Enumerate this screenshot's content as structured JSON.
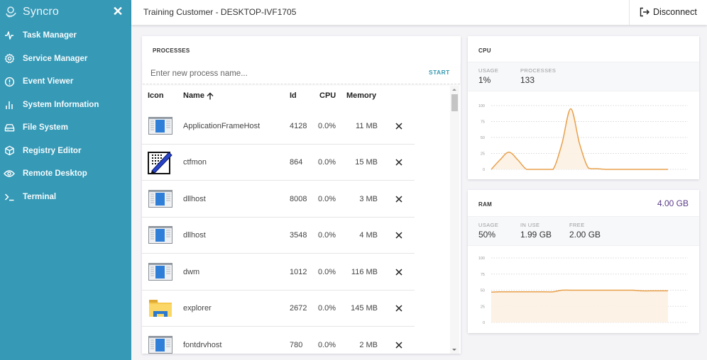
{
  "brand": {
    "name": "Syncro",
    "close_icon": "close-icon"
  },
  "sidebar": {
    "items": [
      {
        "label": "Task Manager",
        "icon": "pulse-icon"
      },
      {
        "label": "Service Manager",
        "icon": "gear-icon"
      },
      {
        "label": "Event Viewer",
        "icon": "alert-circle-icon"
      },
      {
        "label": "System Information",
        "icon": "bar-chart-icon"
      },
      {
        "label": "File System",
        "icon": "hard-drive-icon"
      },
      {
        "label": "Registry Editor",
        "icon": "cube-icon"
      },
      {
        "label": "Remote Desktop",
        "icon": "eye-icon"
      },
      {
        "label": "Terminal",
        "icon": "terminal-icon"
      }
    ]
  },
  "header": {
    "title": "Training Customer - DESKTOP-IVF1705",
    "disconnect_label": "Disconnect"
  },
  "processes": {
    "title": "PROCESSES",
    "input_placeholder": "Enter new process name...",
    "input_value": "",
    "start_label": "START",
    "columns": {
      "icon": "Icon",
      "name": "Name",
      "id": "Id",
      "cpu": "CPU",
      "memory": "Memory"
    },
    "sort": {
      "column": "name",
      "direction": "ascending"
    },
    "rows": [
      {
        "icon": "app-window-icon",
        "name": "ApplicationFrameHost",
        "id": "4128",
        "cpu": "0.0%",
        "memory": "11 MB"
      },
      {
        "icon": "notepad-pen-icon",
        "name": "ctfmon",
        "id": "864",
        "cpu": "0.0%",
        "memory": "15 MB"
      },
      {
        "icon": "app-window-icon",
        "name": "dllhost",
        "id": "8008",
        "cpu": "0.0%",
        "memory": "3 MB"
      },
      {
        "icon": "app-window-icon",
        "name": "dllhost",
        "id": "3548",
        "cpu": "0.0%",
        "memory": "4 MB"
      },
      {
        "icon": "app-window-icon",
        "name": "dwm",
        "id": "1012",
        "cpu": "0.0%",
        "memory": "116 MB"
      },
      {
        "icon": "folder-explorer-icon",
        "name": "explorer",
        "id": "2672",
        "cpu": "0.0%",
        "memory": "145 MB"
      },
      {
        "icon": "app-window-icon",
        "name": "fontdrvhost",
        "id": "780",
        "cpu": "0.0%",
        "memory": "2 MB"
      }
    ]
  },
  "cpu": {
    "title": "CPU",
    "stats": [
      {
        "label": "USAGE",
        "value": "1%"
      },
      {
        "label": "PROCESSES",
        "value": "133"
      }
    ]
  },
  "ram": {
    "title": "RAM",
    "total": "4.00 GB",
    "stats": [
      {
        "label": "USAGE",
        "value": "50%"
      },
      {
        "label": "IN USE",
        "value": "1.99 GB"
      },
      {
        "label": "FREE",
        "value": "2.00 GB"
      }
    ]
  },
  "colors": {
    "sidebar_bg": "#3699b6",
    "accent": "#3a9ab3",
    "chart_line": "#e8a04a",
    "chart_fill": "#fdf1e3",
    "ram_total": "#5b3d8a"
  },
  "chart_data": [
    {
      "type": "area",
      "title": "CPU",
      "ylim": [
        0,
        100
      ],
      "yticks": [
        "0",
        "25",
        "50",
        "75",
        "100"
      ],
      "grid": true,
      "x": [
        0,
        1,
        2,
        3,
        4,
        5,
        6,
        7,
        8,
        9,
        10,
        11,
        12,
        13,
        14,
        15,
        16,
        17,
        18,
        19,
        20
      ],
      "values": [
        0,
        15,
        27,
        15,
        0,
        0,
        0,
        0,
        40,
        95,
        40,
        2,
        1,
        0,
        0,
        0,
        0,
        0,
        0,
        0,
        0
      ]
    },
    {
      "type": "area",
      "title": "RAM",
      "ylim": [
        0,
        100
      ],
      "yticks": [
        "0",
        "25",
        "50",
        "75",
        "100"
      ],
      "grid": true,
      "x": [
        0,
        1,
        2,
        3,
        4,
        5,
        6,
        7,
        8,
        9,
        10,
        11,
        12,
        13,
        14,
        15,
        16,
        17,
        18,
        19,
        20
      ],
      "values": [
        47,
        47.5,
        47.5,
        47.5,
        47.5,
        47.5,
        47.5,
        47.5,
        50,
        50,
        50,
        50,
        50,
        50,
        50,
        50,
        50,
        49,
        49,
        49,
        49
      ]
    }
  ]
}
